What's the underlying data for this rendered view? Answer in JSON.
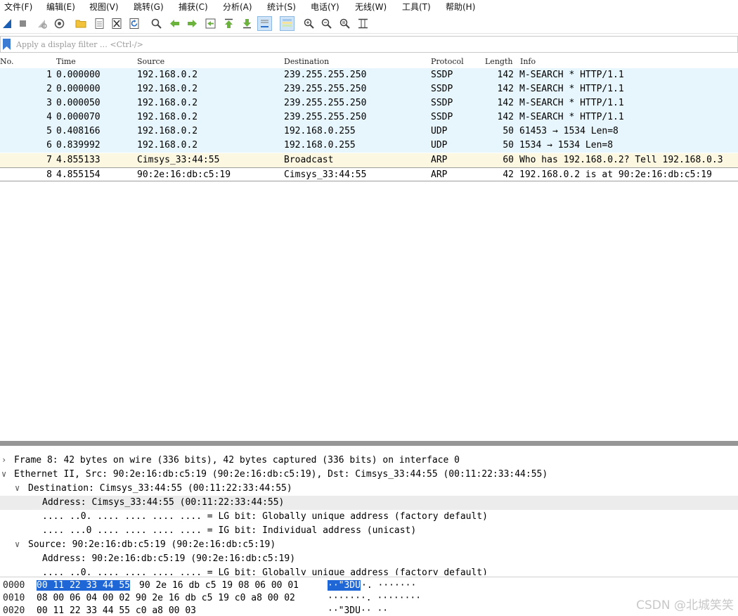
{
  "menu": [
    "文件(F)",
    "编辑(E)",
    "视图(V)",
    "跳转(G)",
    "捕获(C)",
    "分析(A)",
    "统计(S)",
    "电话(Y)",
    "无线(W)",
    "工具(T)",
    "帮助(H)"
  ],
  "toolbar": {
    "icons": [
      "shark-fin-start-icon",
      "stop-icon",
      "restart-icon",
      "capture-options-icon",
      "open-folder-icon",
      "save-file-icon",
      "close-file-icon",
      "reload-icon",
      "find-icon",
      "back-arrow-icon",
      "forward-arrow-icon",
      "go-to-packet-icon",
      "first-packet-icon",
      "last-packet-icon",
      "autoscroll-icon",
      "colorize-icon",
      "zoom-in-icon",
      "zoom-out-icon",
      "normal-size-icon",
      "resize-columns-icon"
    ]
  },
  "filter": {
    "placeholder": "Apply a display filter … <Ctrl-/>"
  },
  "columns": {
    "no": "No.",
    "time": "Time",
    "source": "Source",
    "destination": "Destination",
    "protocol": "Protocol",
    "length": "Length",
    "info": "Info"
  },
  "packets": [
    {
      "no": "1",
      "time": "0.000000",
      "source": "192.168.0.2",
      "destination": "239.255.255.250",
      "protocol": "SSDP",
      "length": "142",
      "info": "M-SEARCH * HTTP/1.1"
    },
    {
      "no": "2",
      "time": "0.000000",
      "source": "192.168.0.2",
      "destination": "239.255.255.250",
      "protocol": "SSDP",
      "length": "142",
      "info": "M-SEARCH * HTTP/1.1"
    },
    {
      "no": "3",
      "time": "0.000050",
      "source": "192.168.0.2",
      "destination": "239.255.255.250",
      "protocol": "SSDP",
      "length": "142",
      "info": "M-SEARCH * HTTP/1.1"
    },
    {
      "no": "4",
      "time": "0.000070",
      "source": "192.168.0.2",
      "destination": "239.255.255.250",
      "protocol": "SSDP",
      "length": "142",
      "info": "M-SEARCH * HTTP/1.1"
    },
    {
      "no": "5",
      "time": "0.408166",
      "source": "192.168.0.2",
      "destination": "192.168.0.255",
      "protocol": "UDP",
      "length": "50",
      "info": "61453 → 1534 Len=8"
    },
    {
      "no": "6",
      "time": "0.839992",
      "source": "192.168.0.2",
      "destination": "192.168.0.255",
      "protocol": "UDP",
      "length": "50",
      "info": "1534 → 1534 Len=8"
    },
    {
      "no": "7",
      "time": "4.855133",
      "source": "Cimsys_33:44:55",
      "destination": "Broadcast",
      "protocol": "ARP",
      "length": "60",
      "info": "Who has 192.168.0.2? Tell 192.168.0.3"
    },
    {
      "no": "8",
      "time": "4.855154",
      "source": "90:2e:16:db:c5:19",
      "destination": "Cimsys_33:44:55",
      "protocol": "ARP",
      "length": "42",
      "info": "192.168.0.2 is at 90:2e:16:db:c5:19"
    }
  ],
  "details": [
    {
      "arrow": "›",
      "text": "Frame 8: 42 bytes on wire (336 bits), 42 bytes captured (336 bits) on interface 0"
    },
    {
      "arrow": "∨",
      "text": "Ethernet II, Src: 90:2e:16:db:c5:19 (90:2e:16:db:c5:19), Dst: Cimsys_33:44:55 (00:11:22:33:44:55)"
    },
    {
      "arrow": "∨",
      "text": "Destination: Cimsys_33:44:55 (00:11:22:33:44:55)"
    },
    {
      "arrow": "",
      "text": "Address: Cimsys_33:44:55 (00:11:22:33:44:55)"
    },
    {
      "arrow": "",
      "text": ".... ..0. .... .... .... .... = LG bit: Globally unique address (factory default)"
    },
    {
      "arrow": "",
      "text": ".... ...0 .... .... .... .... = IG bit: Individual address (unicast)"
    },
    {
      "arrow": "∨",
      "text": "Source: 90:2e:16:db:c5:19 (90:2e:16:db:c5:19)"
    },
    {
      "arrow": "",
      "text": "Address: 90:2e:16:db:c5:19 (90:2e:16:db:c5:19)"
    },
    {
      "arrow": "",
      "text": ".... ..0. .... .... .... .... = LG bit: Globally unique address (factory default)"
    }
  ],
  "bytes": [
    {
      "offset": "0000",
      "hex_sel": "00 11 22 33 44 55",
      "hex_rest": "90 2e  16 db c5 19 08 06 00 01",
      "ascii_sel": "··\"3DU",
      "ascii_rest": "·.  ·······"
    },
    {
      "offset": "0010",
      "hex_sel": "",
      "hex_rest": "08 00 06 04 00 02 90 2e  16 db c5 19 c0 a8 00 02",
      "ascii_sel": "",
      "ascii_rest": "·······.  ········"
    },
    {
      "offset": "0020",
      "hex_sel": "",
      "hex_rest": "00 11 22 33 44 55 c0 a8  00 03",
      "ascii_sel": "",
      "ascii_rest": "··\"3DU·· ··"
    }
  ],
  "watermark": "CSDN @北城笑笑",
  "colors": {
    "ssdp_row": "#e7f6fd",
    "arp_row": "#fcf7e1",
    "selection": "#1f66d6"
  }
}
